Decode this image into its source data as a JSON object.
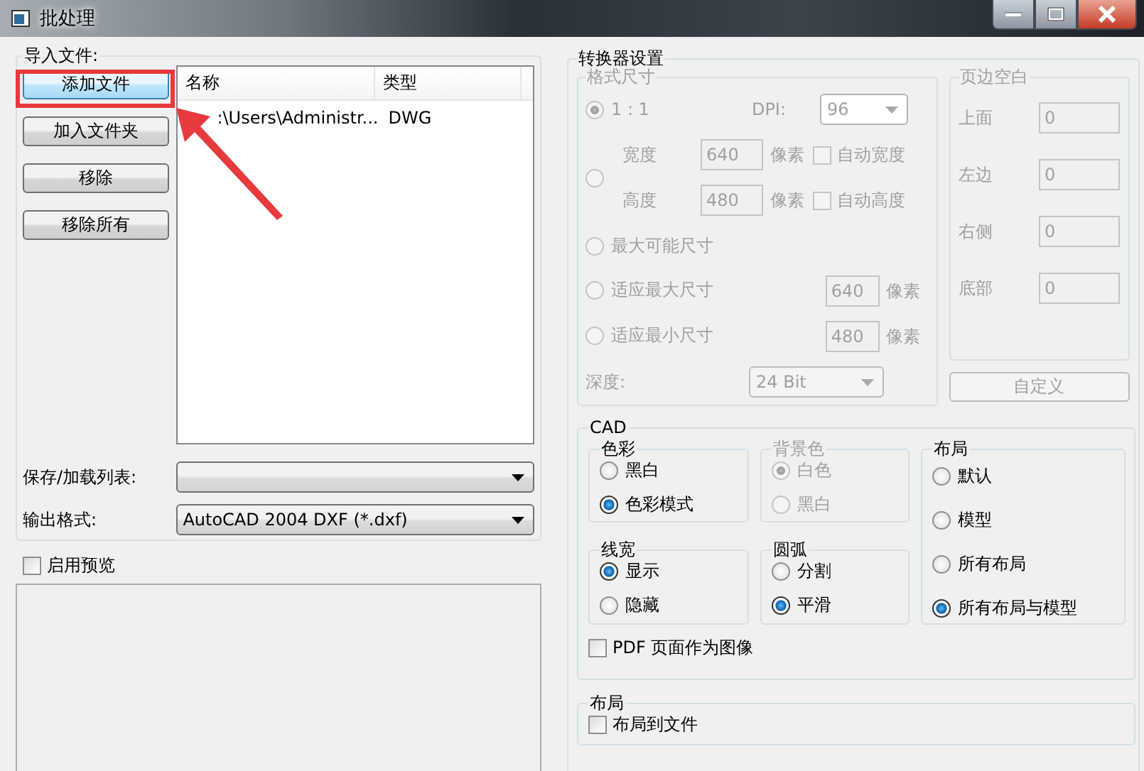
{
  "window": {
    "title": "批处理"
  },
  "import": {
    "title": "导入文件:",
    "buttons": [
      {
        "label": "添加文件",
        "highlighted": true
      },
      {
        "label": "加入文件夹",
        "highlighted": false
      },
      {
        "label": "移除",
        "highlighted": false
      },
      {
        "label": "移除所有",
        "highlighted": false
      }
    ],
    "columns": [
      "名称",
      "类型"
    ],
    "rows": [
      [
        ":\\Users\\Administr...",
        "DWG"
      ]
    ],
    "save_list": {
      "label": "保存/加载列表:"
    },
    "output_format": {
      "label": "输出格式:",
      "value": "AutoCAD 2004 DXF (*.dxf)"
    }
  },
  "preview": {
    "label": "启用预览",
    "checked": false
  },
  "converter": {
    "title": "转换器设置",
    "size": {
      "title": "格式尺寸",
      "disabled": true,
      "one_to_one": {
        "label": "1 : 1",
        "selected": true
      },
      "dpi": {
        "label": "DPI:",
        "value": "96"
      },
      "custom": {
        "selected": false,
        "fields": [
          {
            "label": "宽度",
            "value": "640",
            "unit": "像素",
            "auto": {
              "label": "自动宽度",
              "checked": false
            }
          },
          {
            "label": "高度",
            "value": "480",
            "unit": "像素",
            "auto": {
              "label": "自动高度",
              "checked": false
            }
          }
        ]
      },
      "max_possible": {
        "label": "最大可能尺寸",
        "selected": false
      },
      "fits": [
        {
          "label": "适应最大尺寸",
          "selected": false,
          "value": "640",
          "unit": "像素"
        },
        {
          "label": "适应最小尺寸",
          "selected": false,
          "value": "480",
          "unit": "像素"
        }
      ],
      "depth": {
        "label": "深度:",
        "value": "24 Bit"
      }
    },
    "margins": {
      "title": "页边空白",
      "disabled": true,
      "fields": [
        {
          "label": "上面",
          "value": "0"
        },
        {
          "label": "左边",
          "value": "0"
        },
        {
          "label": "右侧",
          "value": "0"
        },
        {
          "label": "底部",
          "value": "0"
        }
      ]
    },
    "customize_button": {
      "label": "自定义",
      "disabled": true
    }
  },
  "cad": {
    "title": "CAD",
    "groups": [
      {
        "title": "色彩",
        "disabled": false,
        "options": [
          {
            "label": "黑白",
            "selected": false
          },
          {
            "label": "色彩模式",
            "selected": true
          }
        ]
      },
      {
        "title": "背景色",
        "disabled": true,
        "options": [
          {
            "label": "白色",
            "selected": true
          },
          {
            "label": "黑白",
            "selected": false
          }
        ]
      },
      {
        "title": "线宽",
        "disabled": false,
        "options": [
          {
            "label": "显示",
            "selected": true
          },
          {
            "label": "隐藏",
            "selected": false
          }
        ]
      },
      {
        "title": "圆弧",
        "disabled": false,
        "options": [
          {
            "label": "分割",
            "selected": false
          },
          {
            "label": "平滑",
            "selected": true
          }
        ]
      }
    ],
    "layout": {
      "title": "布局",
      "options": [
        {
          "label": "默认",
          "selected": false
        },
        {
          "label": "模型",
          "selected": false
        },
        {
          "label": "所有布局",
          "selected": false
        },
        {
          "label": "所有布局与模型",
          "selected": true
        }
      ]
    },
    "pdf_as_image": {
      "label": "PDF 页面作为图像",
      "checked": false
    }
  },
  "layout": {
    "title": "布局",
    "to_file": {
      "label": "布局到文件",
      "checked": false
    }
  }
}
